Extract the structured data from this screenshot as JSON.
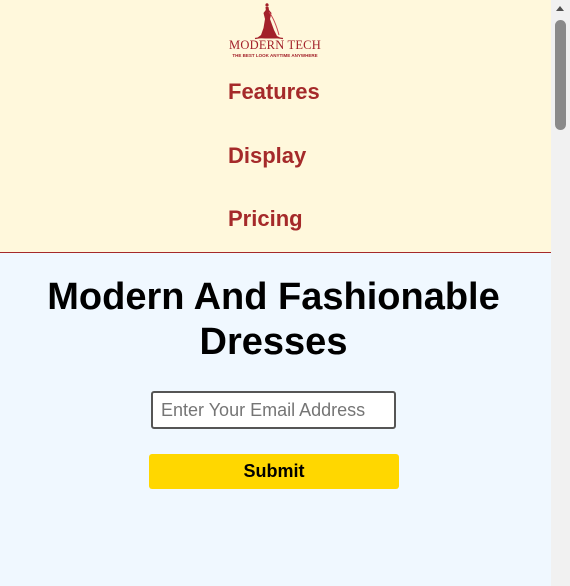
{
  "logo": {
    "title": "MODERN TECH",
    "tagline": "THE BEST LOOK ANYTIME ANYWHERE",
    "brand_color": "#a3212a",
    "icon": "dress-icon"
  },
  "nav": {
    "items": [
      {
        "label": "Features"
      },
      {
        "label": "Display"
      },
      {
        "label": "Pricing"
      }
    ],
    "link_color": "#a52a2a",
    "background": "#fff8dc"
  },
  "hero": {
    "title": "Modern And Fashionable Dresses",
    "background": "#f0f8ff"
  },
  "form": {
    "email_placeholder": "Enter Your Email Address",
    "email_value": "",
    "submit_label": "Submit",
    "submit_color": "#ffd700"
  },
  "scrollbar": {
    "position_fraction": 0.0
  }
}
